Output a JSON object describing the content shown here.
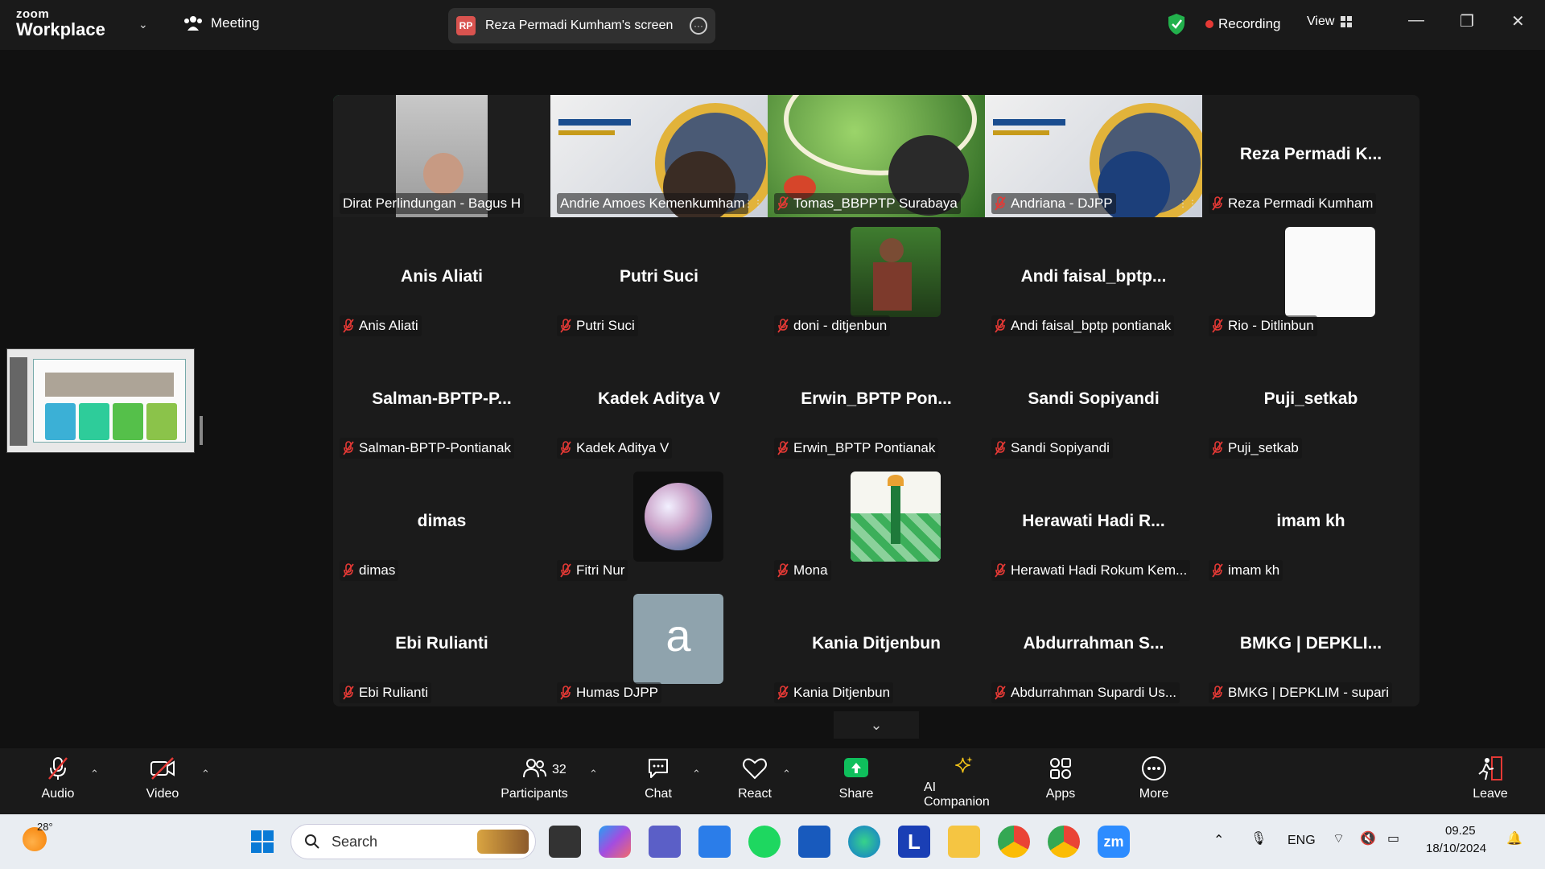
{
  "titlebar": {
    "logo_top": "zoom",
    "logo_bottom": "Workplace",
    "meeting_label": "Meeting",
    "screen_badge": "RP",
    "screen_share_label": "Reza Permadi Kumham's screen",
    "recording_label": "Recording",
    "view_label": "View"
  },
  "gallery": {
    "tiles": [
      {
        "name": "Dirat Perlindungan - Bagus H",
        "big": "",
        "kind": "video-face",
        "muted": false,
        "active": true
      },
      {
        "name": "Andrie Amoes Kemenkumham",
        "big": "",
        "kind": "video-slide",
        "muted": false,
        "active": false
      },
      {
        "name": "Tomas_BBPPTP Surabaya",
        "big": "",
        "kind": "video-garden",
        "muted": true,
        "active": false
      },
      {
        "name": "Andriana - DJPP",
        "big": "",
        "kind": "video-slide2",
        "muted": true,
        "active": false
      },
      {
        "name": "Reza Permadi Kumham",
        "big": "Reza Permadi K...",
        "kind": "text",
        "muted": true,
        "active": false
      },
      {
        "name": "Anis Aliati",
        "big": "Anis Aliati",
        "kind": "text",
        "muted": true
      },
      {
        "name": "Putri Suci",
        "big": "Putri Suci",
        "kind": "text",
        "muted": true
      },
      {
        "name": "doni - ditjenbun",
        "big": "",
        "kind": "avatar-photo",
        "muted": true
      },
      {
        "name": "Andi faisal_bptp pontianak",
        "big": "Andi  faisal_bptp...",
        "kind": "text",
        "muted": true
      },
      {
        "name": "Rio - Ditlinbun",
        "big": "",
        "kind": "avatar-white",
        "muted": true
      },
      {
        "name": "Salman-BPTP-Pontianak",
        "big": "Salman-BPTP-P...",
        "kind": "text",
        "muted": true
      },
      {
        "name": "Kadek Aditya V",
        "big": "Kadek Aditya V",
        "kind": "text",
        "muted": true
      },
      {
        "name": "Erwin_BPTP Pontianak",
        "big": "Erwin_BPTP  Pon...",
        "kind": "text",
        "muted": true
      },
      {
        "name": "Sandi Sopiyandi",
        "big": "Sandi Sopiyandi",
        "kind": "text",
        "muted": true
      },
      {
        "name": "Puji_setkab",
        "big": "Puji_setkab",
        "kind": "text",
        "muted": true
      },
      {
        "name": "dimas",
        "big": "dimas",
        "kind": "text",
        "muted": true
      },
      {
        "name": "Fitri Nur",
        "big": "",
        "kind": "avatar-moon",
        "muted": true
      },
      {
        "name": "Mona",
        "big": "",
        "kind": "avatar-monument",
        "muted": true
      },
      {
        "name": "Herawati Hadi Rokum Kem...",
        "big": "Herawati Hadi R...",
        "kind": "text",
        "muted": true
      },
      {
        "name": "imam kh",
        "big": "imam kh",
        "kind": "text",
        "muted": true
      },
      {
        "name": "Ebi Rulianti",
        "big": "Ebi Rulianti",
        "kind": "text",
        "muted": true
      },
      {
        "name": "Humas DJPP",
        "big": "",
        "kind": "avatar-letter",
        "letter": "a",
        "muted": true
      },
      {
        "name": "Kania Ditjenbun",
        "big": "Kania Ditjenbun",
        "kind": "text",
        "muted": true
      },
      {
        "name": "Abdurrahman Supardi Us...",
        "big": "Abdurrahman  S...",
        "kind": "text",
        "muted": true
      },
      {
        "name": "BMKG | DEPKLIM - supari",
        "big": "BMKG | DEPKLI...",
        "kind": "text",
        "muted": true
      }
    ]
  },
  "toolbar": {
    "audio": "Audio",
    "video": "Video",
    "participants": "Participants",
    "participants_count": "32",
    "chat": "Chat",
    "react": "React",
    "share": "Share",
    "ai": "AI Companion",
    "apps": "Apps",
    "more": "More",
    "leave": "Leave"
  },
  "taskbar": {
    "weather_temp": "28°",
    "search_placeholder": "Search",
    "lang": "ENG",
    "time": "09.25",
    "date": "18/10/2024"
  },
  "colors": {
    "active_border": "#25c26e",
    "share_green": "#0fbf5c",
    "mute_red": "#e53935"
  }
}
